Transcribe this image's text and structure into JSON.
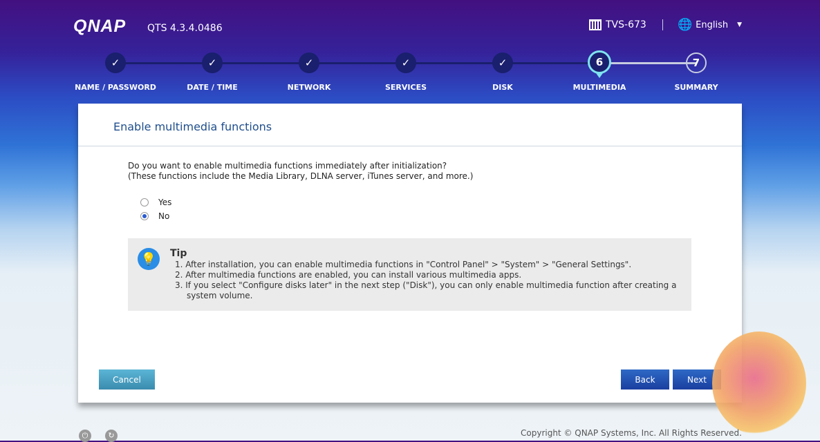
{
  "header": {
    "brand": "QNAP",
    "version": "QTS 4.3.4.0486",
    "model": "TVS-673",
    "language": "English"
  },
  "steps": [
    {
      "label": "NAME / PASSWORD",
      "marker": "✓"
    },
    {
      "label": "DATE / TIME",
      "marker": "✓"
    },
    {
      "label": "NETWORK",
      "marker": "✓"
    },
    {
      "label": "SERVICES",
      "marker": "✓"
    },
    {
      "label": "DISK",
      "marker": "✓"
    },
    {
      "label": "MULTIMEDIA",
      "marker": "6"
    },
    {
      "label": "SUMMARY",
      "marker": "7"
    }
  ],
  "panel": {
    "title": "Enable multimedia functions",
    "question": "Do you want to enable multimedia functions immediately after initialization?",
    "note": "(These functions include the Media Library, DLNA server, iTunes server, and more.)",
    "options": [
      {
        "label": "Yes",
        "selected": false
      },
      {
        "label": "No",
        "selected": true
      }
    ],
    "tip": {
      "title": "Tip",
      "items": [
        "1. After installation, you can enable multimedia functions in \"Control Panel\" > \"System\" > \"General Settings\".",
        "2. After multimedia functions are enabled, you can install various multimedia apps.",
        "3. If you select \"Configure disks later\" in the next step (\"Disk\"), you can only enable multimedia function after creating a system volume."
      ]
    },
    "buttons": {
      "cancel": "Cancel",
      "back": "Back",
      "next": "Next"
    }
  },
  "footer": {
    "copyright": "Copyright © QNAP Systems, Inc. All Rights Reserved."
  }
}
